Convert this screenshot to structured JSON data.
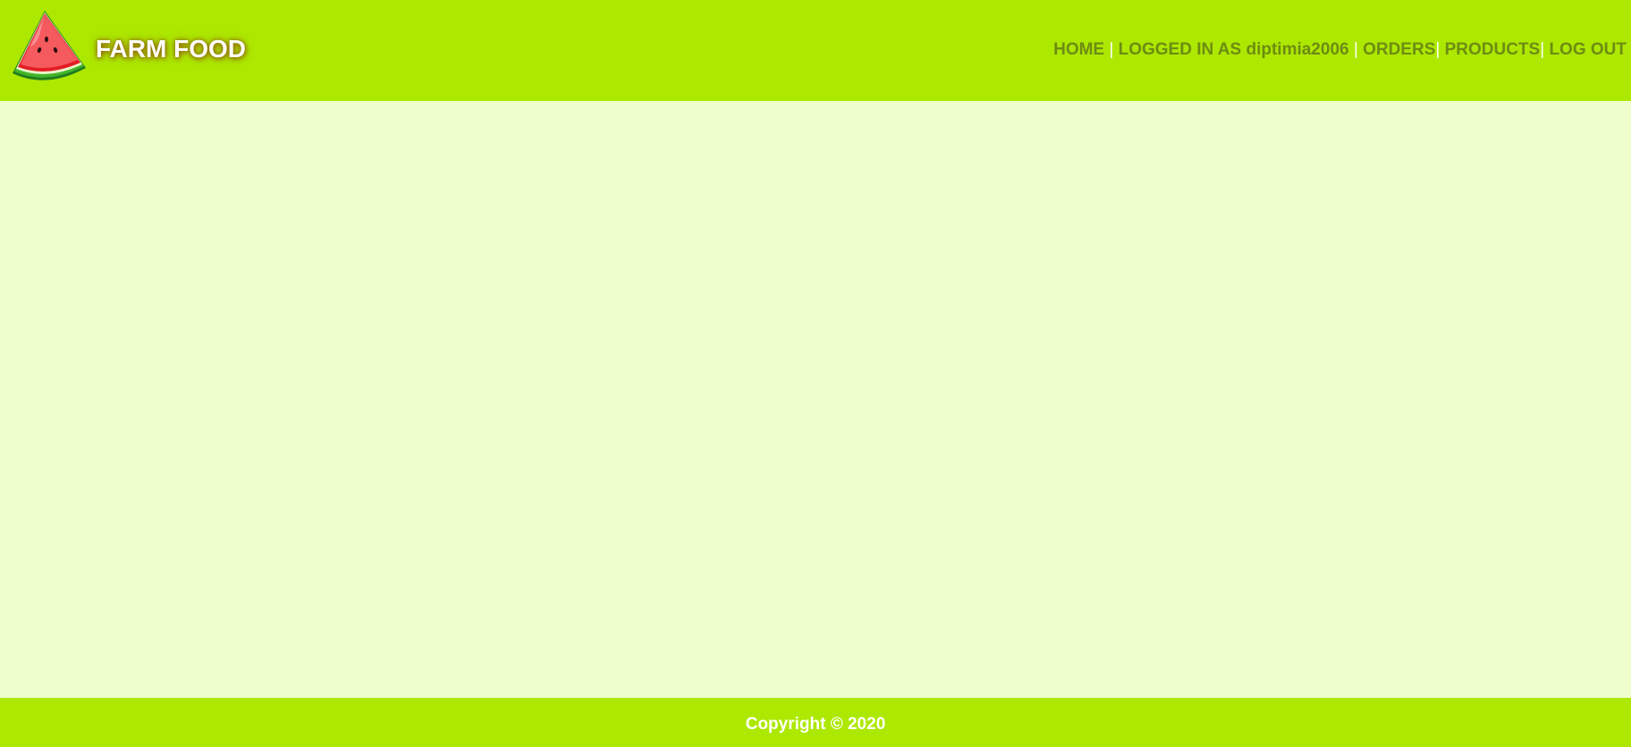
{
  "header": {
    "brand": "FARM FOOD",
    "logo_icon": "watermelon-slice-icon",
    "background_color": "#ade800"
  },
  "nav": {
    "home": "HOME",
    "separator": "|",
    "logged_in_prefix": "LOGGED IN AS",
    "username": "diptimia2006",
    "orders": "ORDERS",
    "products": "PRODUCTS",
    "logout": "LOG OUT",
    "link_color": "#6e8c12"
  },
  "main": {
    "background_color": "#eeffcc"
  },
  "footer": {
    "copyright": "Copyright © 2020",
    "background_color": "#ade800"
  }
}
